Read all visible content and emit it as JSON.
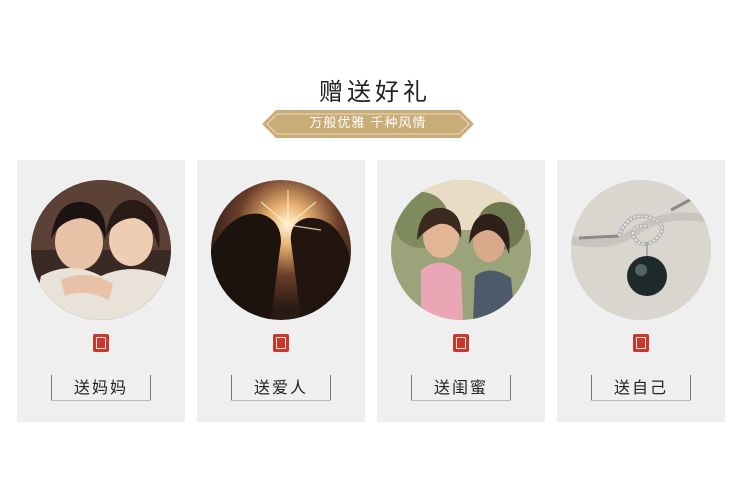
{
  "header": {
    "title": "赠送好礼",
    "subtitle": "万般优雅 千种风情",
    "banner_color": "#c9ac78"
  },
  "cards": [
    {
      "label": "送妈妈",
      "photo": "mother-daughter-photo"
    },
    {
      "label": "送爱人",
      "photo": "couple-sunset-photo"
    },
    {
      "label": "送闺蜜",
      "photo": "girlfriends-photo"
    },
    {
      "label": "送自己",
      "photo": "pearl-pendant-photo"
    }
  ],
  "seal_icon": "red-seal-icon",
  "seal_color": "#c8392b",
  "card_bg": "#efefef"
}
